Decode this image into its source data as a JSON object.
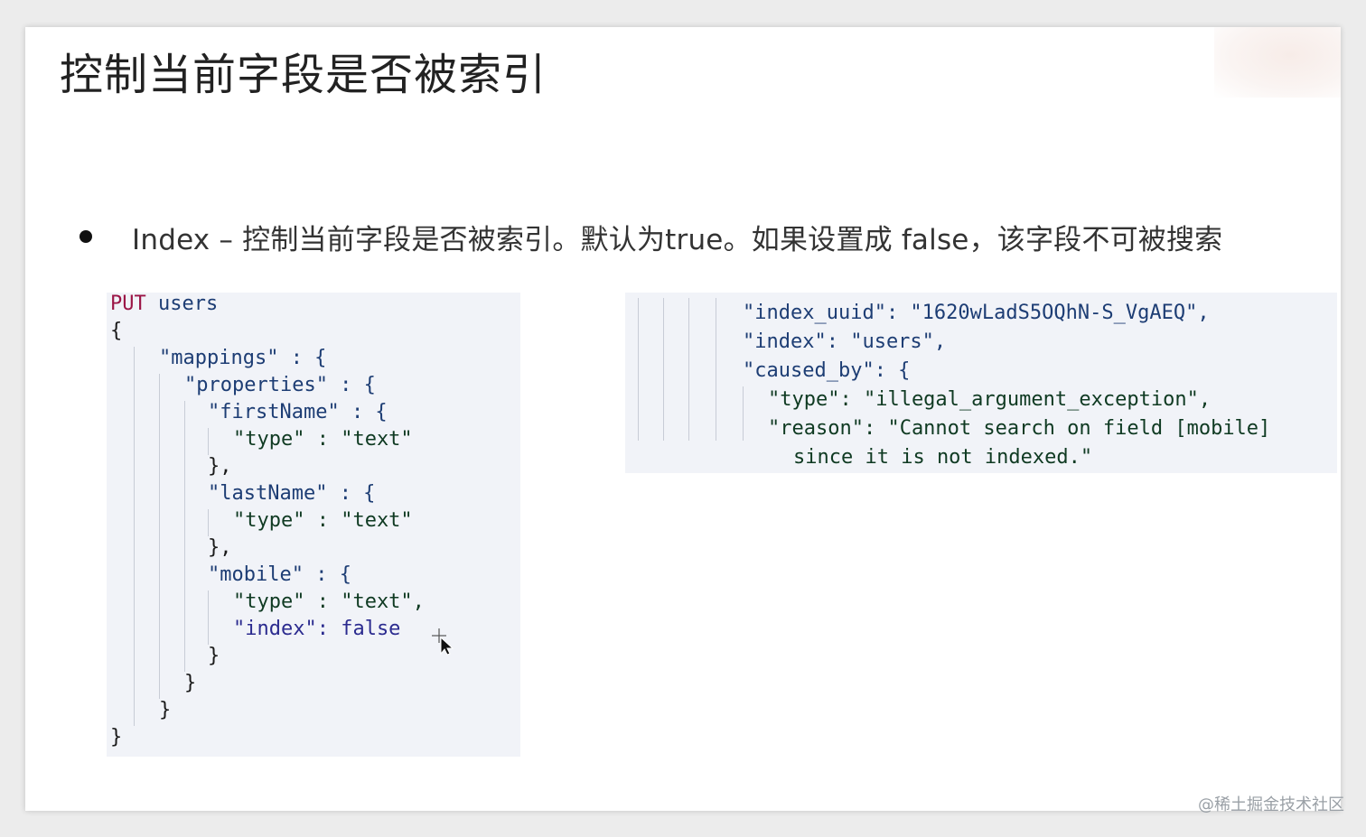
{
  "slide": {
    "title": "控制当前字段是否被索引",
    "bullet": "Index – 控制当前字段是否被索引。默认为true。如果设置成  false，该字段不可被搜索"
  },
  "request_code": {
    "method": "PUT",
    "endpoint": "users",
    "lines": [
      "{",
      "\"mappings\" : {",
      "\"properties\" : {",
      "\"firstName\" : {",
      "\"type\" : \"text\"",
      "},",
      "\"lastName\" : {",
      "\"type\" : \"text\"",
      "},",
      "\"mobile\" : {",
      "\"type\" : \"text\",",
      "\"index\": false",
      "}",
      "}",
      "}",
      "}"
    ]
  },
  "response_code": {
    "lines": [
      "\"index_uuid\": \"1620wLadS5OQhN-S_VgAEQ\",",
      "\"index\": \"users\",",
      "\"caused_by\": {",
      "\"type\": \"illegal_argument_exception\",",
      "\"reason\": \"Cannot search on field [mobile]",
      "since it is not indexed.\""
    ]
  },
  "watermark": "@稀土掘金技术社区",
  "icons": {
    "bullet": "bullet-dot",
    "cursor": "move-cursor-icon"
  },
  "colors": {
    "code_background": "#f1f3f8",
    "method": "#9b1546",
    "keys": "#1d3d74",
    "strings": "#0f3a22",
    "boolean": "#2b2b8f"
  }
}
